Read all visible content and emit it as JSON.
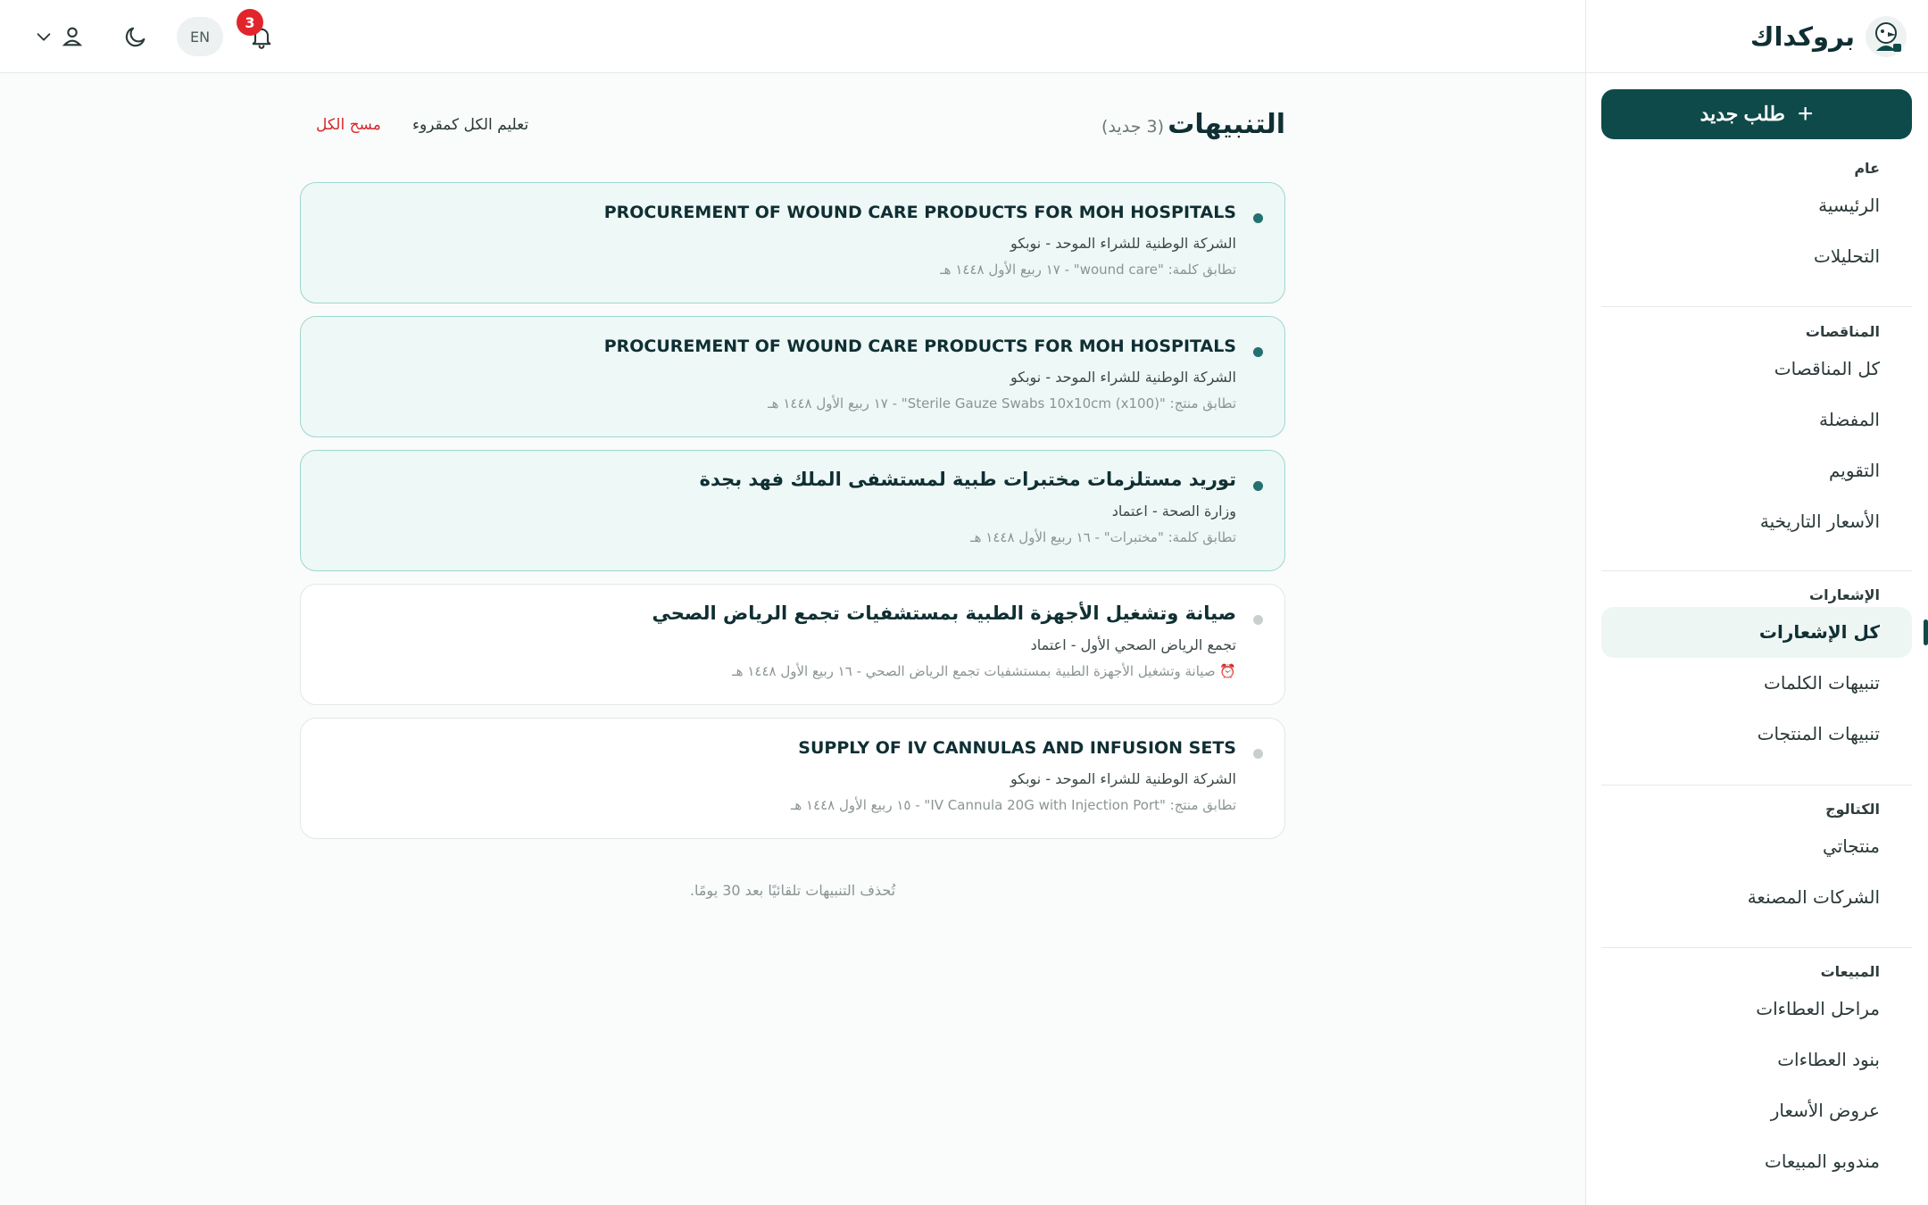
{
  "brand": {
    "name": "بروكداك"
  },
  "sidebar": {
    "new_request_label": "طلب جديد",
    "sections": [
      {
        "heading": "عام",
        "items": [
          "الرئيسية",
          "التحليلات"
        ]
      },
      {
        "heading": "المناقصات",
        "items": [
          "كل المناقصات",
          "المفضلة",
          "التقويم",
          "الأسعار التاريخية"
        ]
      },
      {
        "heading": "الإشعارات",
        "items": [
          "كل الإشعارات",
          "تنبيهات الكلمات",
          "تنبيهات المنتجات"
        ]
      },
      {
        "heading": "الكتالوج",
        "items": [
          "منتجاتي",
          "الشركات المصنعة"
        ]
      },
      {
        "heading": "المبيعات",
        "items": [
          "مراحل العطاءات",
          "بنود العطاءات",
          "عروض الأسعار",
          "مندوبو المبيعات"
        ]
      }
    ],
    "active_item": "كل الإشعارات"
  },
  "topbar": {
    "language": "EN",
    "notification_count": "3",
    "icons": [
      "bell-icon",
      "moon-icon",
      "user-icon",
      "chevron-down-icon"
    ]
  },
  "page": {
    "title": "التنبيهات",
    "new_count": "(3 جديد)",
    "mark_all_read": "تعليم الكل كمقروء",
    "clear_all": "مسح الكل",
    "footnote": "تُحذف التنبيهات تلقائيًا بعد 30 يومًا."
  },
  "notifications": [
    {
      "title": "PROCUREMENT OF WOUND CARE PRODUCTS FOR MOH HOSPITALS",
      "org": "الشركة الوطنية للشراء الموحد - نوبكو",
      "match": "تطابق كلمة: \"wound care\" - ١٧ ربيع الأول ١٤٤٨ هـ",
      "unread": true
    },
    {
      "title": "PROCUREMENT OF WOUND CARE PRODUCTS FOR MOH HOSPITALS",
      "org": "الشركة الوطنية للشراء الموحد - نوبكو",
      "match": "تطابق منتج: \"Sterile Gauze Swabs 10x10cm (x100)\" - ١٧ ربيع الأول ١٤٤٨ هـ",
      "unread": true
    },
    {
      "title": "توريد مستلزمات مختبرات طبية لمستشفى الملك فهد بجدة",
      "org": "وزارة الصحة - اعتماد",
      "match": "تطابق كلمة: \"مختبرات\" - ١٦ ربيع الأول ١٤٤٨ هـ",
      "unread": true
    },
    {
      "title": "صيانة وتشغيل الأجهزة الطبية بمستشفيات تجمع الرياض الصحي",
      "org": "تجمع الرياض الصحي الأول - اعتماد",
      "match": "⏰ صيانة وتشغيل الأجهزة الطبية بمستشفيات تجمع الرياض الصحي - ١٦ ربيع الأول ١٤٤٨ هـ",
      "unread": false
    },
    {
      "title": "SUPPLY OF IV CANNULAS AND INFUSION SETS",
      "org": "الشركة الوطنية للشراء الموحد - نوبكو",
      "match": "تطابق منتج: \"IV Cannula 20G with Injection Port\" - ١٥ ربيع الأول ١٤٤٨ هـ",
      "unread": false
    }
  ]
}
